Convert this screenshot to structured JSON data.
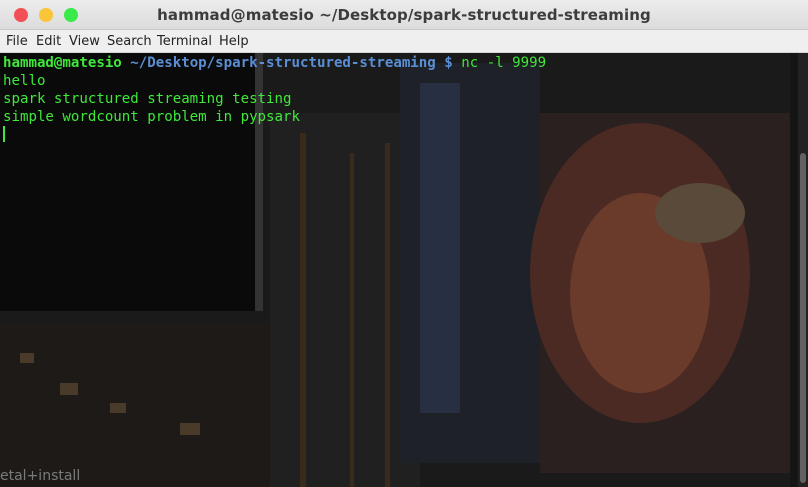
{
  "window": {
    "title": "hammad@matesio ~/Desktop/spark-structured-streaming"
  },
  "menu": [
    "File",
    "Edit",
    "View",
    "Search",
    "Terminal",
    "Help"
  ],
  "terminal": {
    "prompt_user": "hammad@matesio",
    "prompt_path": "~/Desktop/spark-structured-streaming",
    "prompt_symbol": "$",
    "command": "nc -l 9999",
    "output": [
      "hello",
      "spark structured streaming testing",
      "simple wordcount problem in pypsark"
    ]
  },
  "background_text": "etal+install",
  "colors": {
    "text_green": "#3fe83a",
    "path_blue": "#5a8fd6",
    "close": "#f25056",
    "minimize": "#fac536",
    "maximize": "#39ea49"
  }
}
